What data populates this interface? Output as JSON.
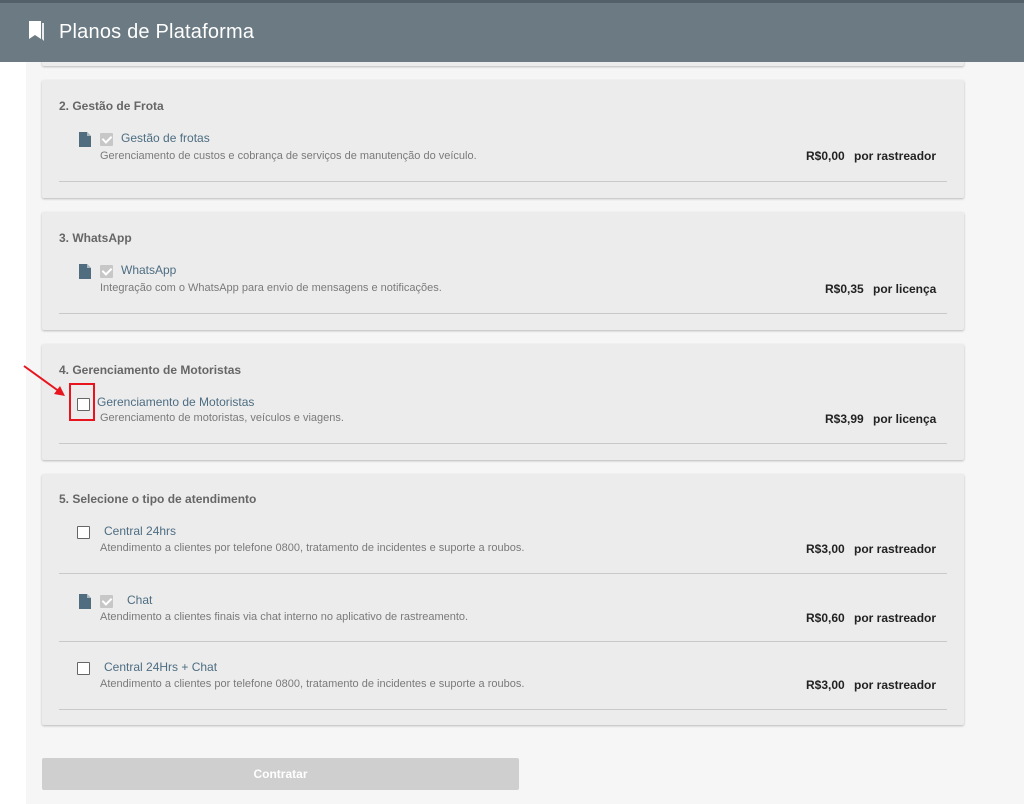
{
  "header": {
    "title": "Planos de Plataforma",
    "icon": "bookmark-book-icon",
    "bg_color": "#6b7a83"
  },
  "sections": [
    {
      "title": "2. Gestão de Frota",
      "items": [
        {
          "name": "Gestão de frotas",
          "desc": "Gerenciamento de custos e cobrança de serviços de manutenção do veículo.",
          "price": "R$0,00",
          "unit": "por rastreador",
          "checked": true,
          "disabled": true
        }
      ]
    },
    {
      "title": "3. WhatsApp",
      "items": [
        {
          "name": "WhatsApp",
          "desc": "Integração com o WhatsApp para envio de mensagens e notificações.",
          "price": "R$0,35",
          "unit": "por licença",
          "checked": true,
          "disabled": true
        }
      ]
    },
    {
      "title": "4. Gerenciamento de Motoristas",
      "items": [
        {
          "name": "Gerenciamento de Motoristas",
          "desc": "Gerenciamento de motoristas, veículos e viagens.",
          "price": "R$3,99",
          "unit": "por licença",
          "checked": false,
          "disabled": false
        }
      ]
    },
    {
      "title": "5. Selecione o tipo de atendimento",
      "items": [
        {
          "name": "Central 24hrs",
          "desc": "Atendimento a clientes por telefone 0800, tratamento de incidentes e suporte a roubos.",
          "price": "R$3,00",
          "unit": "por rastreador",
          "checked": false,
          "disabled": false
        },
        {
          "name": "Chat",
          "desc": "Atendimento a clientes finais via chat interno no aplicativo de rastreamento.",
          "price": "R$0,60",
          "unit": "por rastreador",
          "checked": true,
          "disabled": true
        },
        {
          "name": "Central 24Hrs + Chat",
          "desc": "Atendimento a clientes por telefone 0800, tratamento de incidentes e suporte a roubos.",
          "price": "R$3,00",
          "unit": "por rastreador",
          "checked": false,
          "disabled": false
        }
      ]
    }
  ],
  "actions": {
    "submit_label": "Contratar"
  },
  "annotation": {
    "highlight_color": "#e8141e"
  },
  "colors": {
    "link": "#4d6d82",
    "card_bg": "#ececec"
  }
}
